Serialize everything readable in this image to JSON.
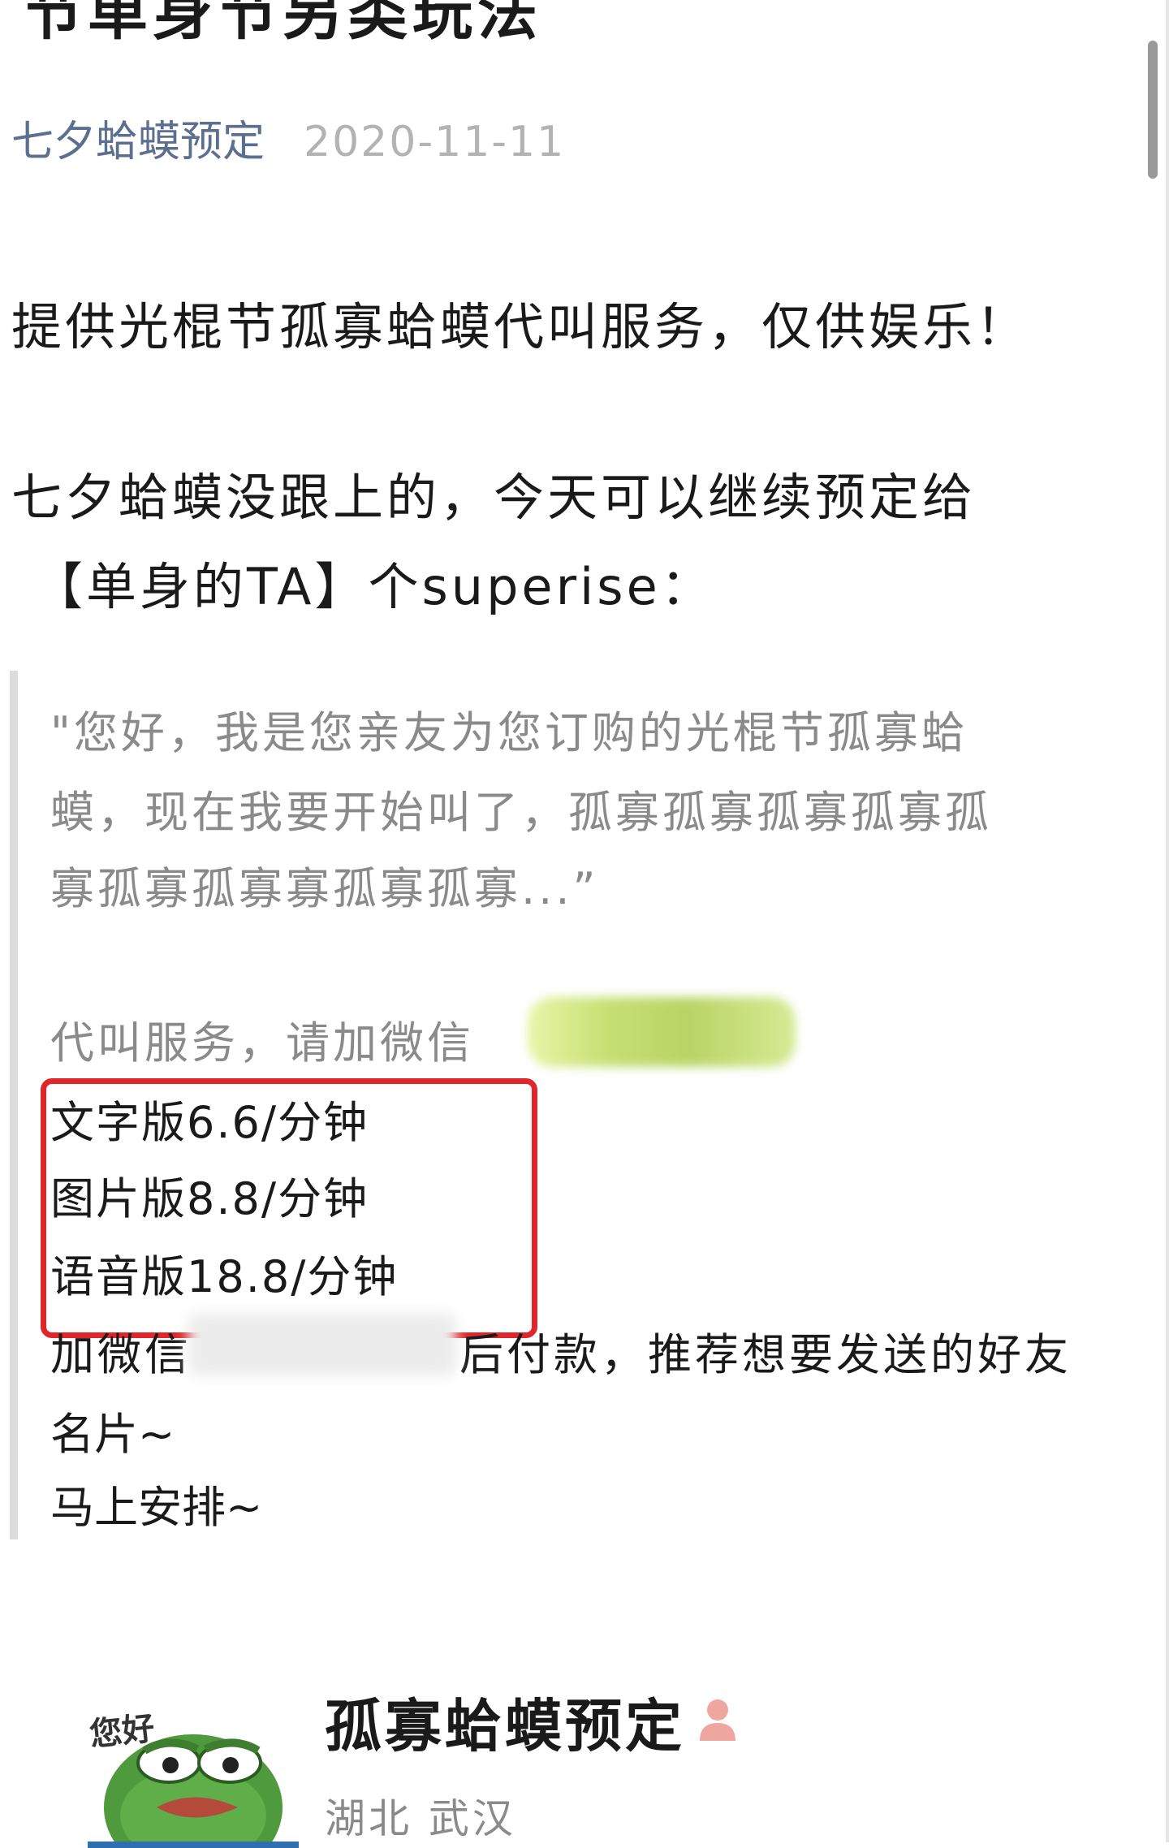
{
  "article": {
    "title_fragment": "节单身节另类玩法",
    "author": "七夕蛤蟆预定",
    "date": "2020-11-11",
    "intro": "提供光棍节孤寡蛤蟆代叫服务，仅供娱乐！",
    "line2a": "七夕蛤蟆没跟上的，今天可以继续预定给",
    "line2b": "【单身的TA】个superise："
  },
  "quote": {
    "line1": "\"您好，我是您亲友为您订购的光棍节孤寡蛤",
    "line2": "蟆，现在我要开始叫了，孤寡孤寡孤寡孤寡孤",
    "line3": "寡孤寡孤寡寡孤寡孤寡...”",
    "wechat_label": "代叫服务，请加微信",
    "prices": [
      "文字版6.6/分钟",
      "图片版8.8/分钟",
      "语音版18.8/分钟"
    ],
    "pay_prefix": "加微信",
    "pay_suffix": "后付款，推荐想要发送的好友",
    "pay_line2": "名片~",
    "pay_line3": "马上安排~"
  },
  "card": {
    "avatar_text": "您好",
    "title": "孤寡蛤蟆预定",
    "location": "湖北 武汉",
    "person_icon": "person-icon"
  },
  "colors": {
    "author": "#5c6f8f",
    "highlight_box": "#e0262a",
    "quote_text": "#8a8a8a"
  }
}
